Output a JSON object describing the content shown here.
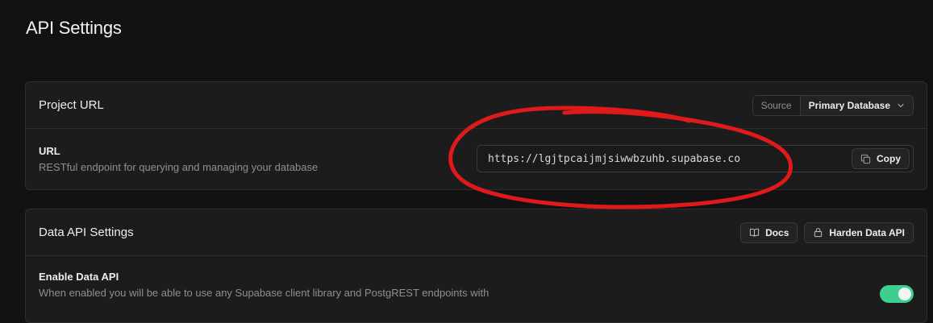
{
  "page": {
    "title": "API Settings"
  },
  "project_url_card": {
    "title": "Project URL",
    "source_label": "Source",
    "source_value": "Primary Database",
    "url_row": {
      "label": "URL",
      "description": "RESTful endpoint for querying and managing your database",
      "value": "https://lgjtpcaijmjsiwwbzuhb.supabase.co",
      "copy_label": "Copy"
    }
  },
  "data_api_card": {
    "title": "Data API Settings",
    "docs_label": "Docs",
    "harden_label": "Harden Data API",
    "enable_row": {
      "label": "Enable Data API",
      "description": "When enabled you will be able to use any Supabase client library and PostgREST endpoints with",
      "enabled": true
    }
  },
  "colors": {
    "background": "#121212",
    "card": "#1c1c1c",
    "toggle_on": "#3ecf8e",
    "annotation": "#e0191b"
  },
  "icons": [
    "chevron-down-icon",
    "copy-icon",
    "book-icon",
    "lock-icon"
  ]
}
